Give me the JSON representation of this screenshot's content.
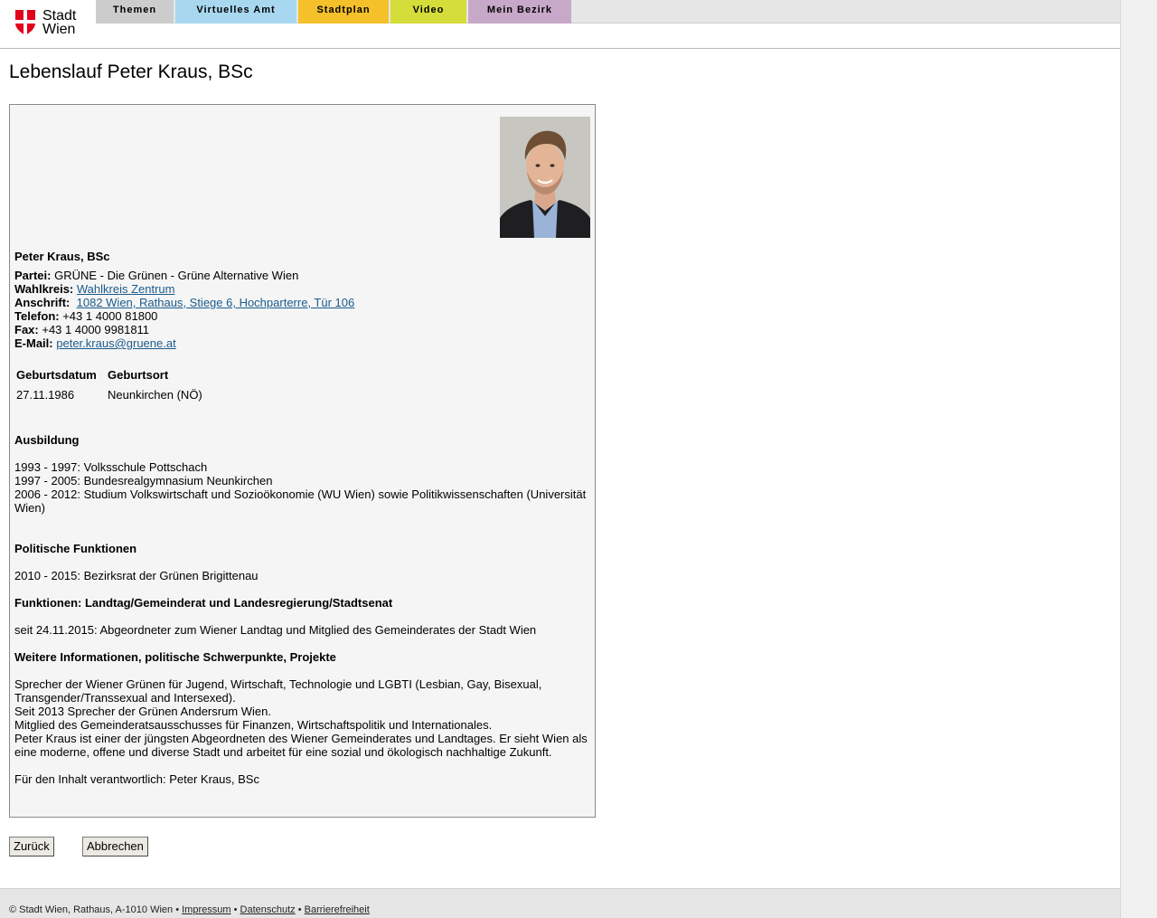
{
  "header": {
    "logo_line1": "Stadt",
    "logo_line2": "Wien",
    "nav": [
      {
        "label": "Themen",
        "color": "#cccccc"
      },
      {
        "label": "Virtuelles Amt",
        "color": "#a8d8f0"
      },
      {
        "label": "Stadtplan",
        "color": "#f5c12a"
      },
      {
        "label": "Video",
        "color": "#d4dd3a"
      },
      {
        "label": "Mein Bezirk",
        "color": "#c8a8c8"
      }
    ]
  },
  "page_title": "Lebenslauf Peter Kraus, BSc",
  "profile": {
    "name": "Peter Kraus, BSc",
    "partei_label": "Partei:",
    "partei_value": "GRÜNE - Die Grünen - Grüne Alternative Wien",
    "wahlkreis_label": "Wahlkreis:",
    "wahlkreis_value": "Wahlkreis Zentrum",
    "anschrift_label": "Anschrift:",
    "anschrift_value": "1082 Wien, Rathaus, Stiege 6, Hochparterre, Tür 106",
    "telefon_label": "Telefon:",
    "telefon_value": "+43 1 4000 81800",
    "fax_label": "Fax:",
    "fax_value": "+43 1 4000 9981811",
    "email_label": "E-Mail:",
    "email_value": "peter.kraus@gruene.at",
    "birth_table": {
      "headers": [
        "Geburtsdatum",
        "Geburtsort"
      ],
      "row": [
        "27.11.1986",
        "Neunkirchen (NÖ)"
      ]
    },
    "ausbildung_heading": "Ausbildung",
    "ausbildung": [
      "1993 - 1997: Volksschule Pottschach",
      "1997 - 2005: Bundesrealgymnasium Neunkirchen",
      "2006 - 2012: Studium Volkswirtschaft und Sozioökonomie (WU Wien) sowie Politikwissenschaften (Universität Wien)"
    ],
    "polit_heading": "Politische Funktionen",
    "polit_text": "2010 - 2015: Bezirksrat der Grünen Brigittenau",
    "funktionen_heading": "Funktionen: Landtag/Gemeinderat und Landesregierung/Stadtsenat",
    "funktionen_text": "seit 24.11.2015: Abgeordneter zum Wiener Landtag und Mitglied des Gemeinderates der Stadt Wien",
    "weitere_heading": "Weitere Informationen, politische Schwerpunkte, Projekte",
    "weitere_text": [
      "Sprecher der Wiener Grünen für Jugend, Wirtschaft, Technologie und LGBTI (Lesbian, Gay, Bisexual, Transgender/Transsexual and Intersexed).",
      "Seit 2013 Sprecher der Grünen Andersrum Wien.",
      "Mitglied des Gemeinderatsausschusses für Finanzen, Wirtschaftspolitik und Internationales.",
      "Peter Kraus ist einer der jüngsten Abgeordneten des Wiener Gemeinderates und Landtages. Er sieht Wien als eine moderne, offene und diverse Stadt und arbeitet für eine sozial und ökologisch nachhaltige Zukunft."
    ],
    "verantwortlich": "Für den Inhalt verantwortlich: Peter Kraus, BSc"
  },
  "buttons": {
    "back": "Zurück",
    "cancel": "Abbrechen"
  },
  "footer": {
    "copyright": "© Stadt Wien, Rathaus, A-1010 Wien •",
    "impressum": "Impressum",
    "sep1": "•",
    "datenschutz": "Datenschutz",
    "sep2": "•",
    "barrierefreiheit": "Barrierefreiheit"
  },
  "colors": {
    "logo_red": "#e2001a",
    "link_blue": "#1a5b8c",
    "box_bg": "#f5f5f5"
  }
}
